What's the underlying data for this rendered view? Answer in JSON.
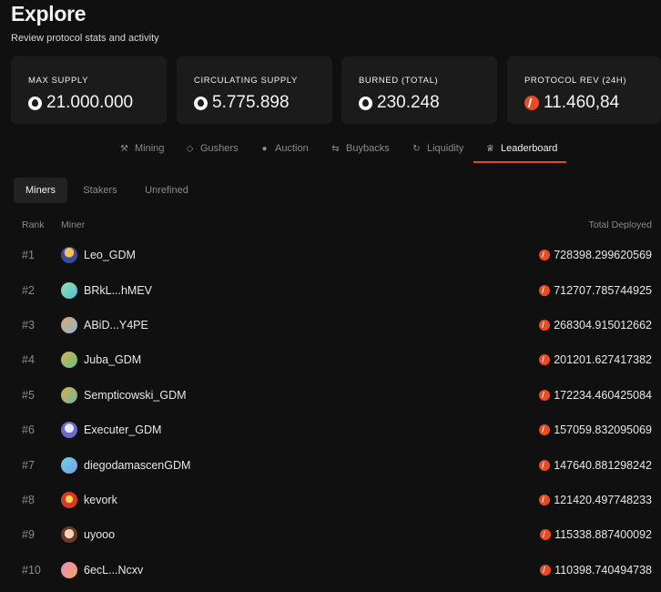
{
  "header": {
    "title": "Explore",
    "subtitle": "Review protocol stats and activity"
  },
  "stats": [
    {
      "label": "MAX SUPPLY",
      "value": "21.000.000",
      "icon": "ore-icon"
    },
    {
      "label": "CIRCULATING SUPPLY",
      "value": "5.775.898",
      "icon": "ore-icon"
    },
    {
      "label": "BURNED (TOTAL)",
      "value": "230.248",
      "icon": "ore-icon"
    },
    {
      "label": "PROTOCOL REV (24H)",
      "value": "11.460,84",
      "icon": "sol-icon"
    }
  ],
  "tabs": [
    {
      "label": "Mining",
      "icon": "pickaxe-icon"
    },
    {
      "label": "Gushers",
      "icon": "gem-icon"
    },
    {
      "label": "Auction",
      "icon": "user-icon"
    },
    {
      "label": "Buybacks",
      "icon": "swap-icon"
    },
    {
      "label": "Liquidity",
      "icon": "refresh-icon"
    },
    {
      "label": "Leaderboard",
      "icon": "trophy-icon",
      "active": true
    }
  ],
  "subtabs": [
    {
      "label": "Miners",
      "active": true
    },
    {
      "label": "Stakers"
    },
    {
      "label": "Unrefined"
    }
  ],
  "table": {
    "headers": {
      "rank": "Rank",
      "miner": "Miner",
      "total": "Total Deployed"
    },
    "rows": [
      {
        "rank": "#1",
        "miner": "Leo_GDM",
        "total": "728398.299620569"
      },
      {
        "rank": "#2",
        "miner": "BRkL...hMEV",
        "total": "712707.785744925"
      },
      {
        "rank": "#3",
        "miner": "ABiD...Y4PE",
        "total": "268304.915012662"
      },
      {
        "rank": "#4",
        "miner": "Juba_GDM",
        "total": "201201.627417382"
      },
      {
        "rank": "#5",
        "miner": "Sempticowski_GDM",
        "total": "172234.460425084"
      },
      {
        "rank": "#6",
        "miner": "Executer_GDM",
        "total": "157059.832095069"
      },
      {
        "rank": "#7",
        "miner": "diegodamascenGDM",
        "total": "147640.881298242"
      },
      {
        "rank": "#8",
        "miner": "kevork",
        "total": "121420.497748233"
      },
      {
        "rank": "#9",
        "miner": "uyooo",
        "total": "115338.887400092"
      },
      {
        "rank": "#10",
        "miner": "6ecL...Ncxv",
        "total": "110398.740494738"
      }
    ]
  },
  "colors": {
    "accent": "#e04a2a",
    "sol": "#ec4a22",
    "background": "#101010",
    "card": "#1b1b1b"
  }
}
